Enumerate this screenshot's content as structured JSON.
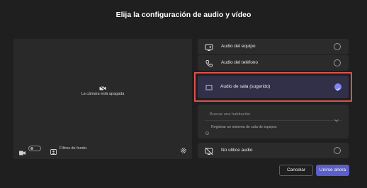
{
  "dialog": {
    "title": "Elija la configuración de audio y vídeo"
  },
  "preview": {
    "camera_off_text": "La cámara está apagada",
    "background_filters_label": "Filtros de fondo."
  },
  "audio_options": {
    "computer": "Audio del equipo",
    "phone": "Audio del teléfono",
    "room": "Audio de sala (sugerido)",
    "room_search_placeholder": "Buscar una habitación",
    "room_hint": "Registrar un sistema de sala de equipos",
    "no_audio": "No utilice audio"
  },
  "buttons": {
    "cancel": "Cancelar",
    "join": "Unirse ahora"
  },
  "colors": {
    "accent": "#5b5fc7",
    "highlight_border": "#d9534f",
    "selected_bg": "#313048"
  }
}
